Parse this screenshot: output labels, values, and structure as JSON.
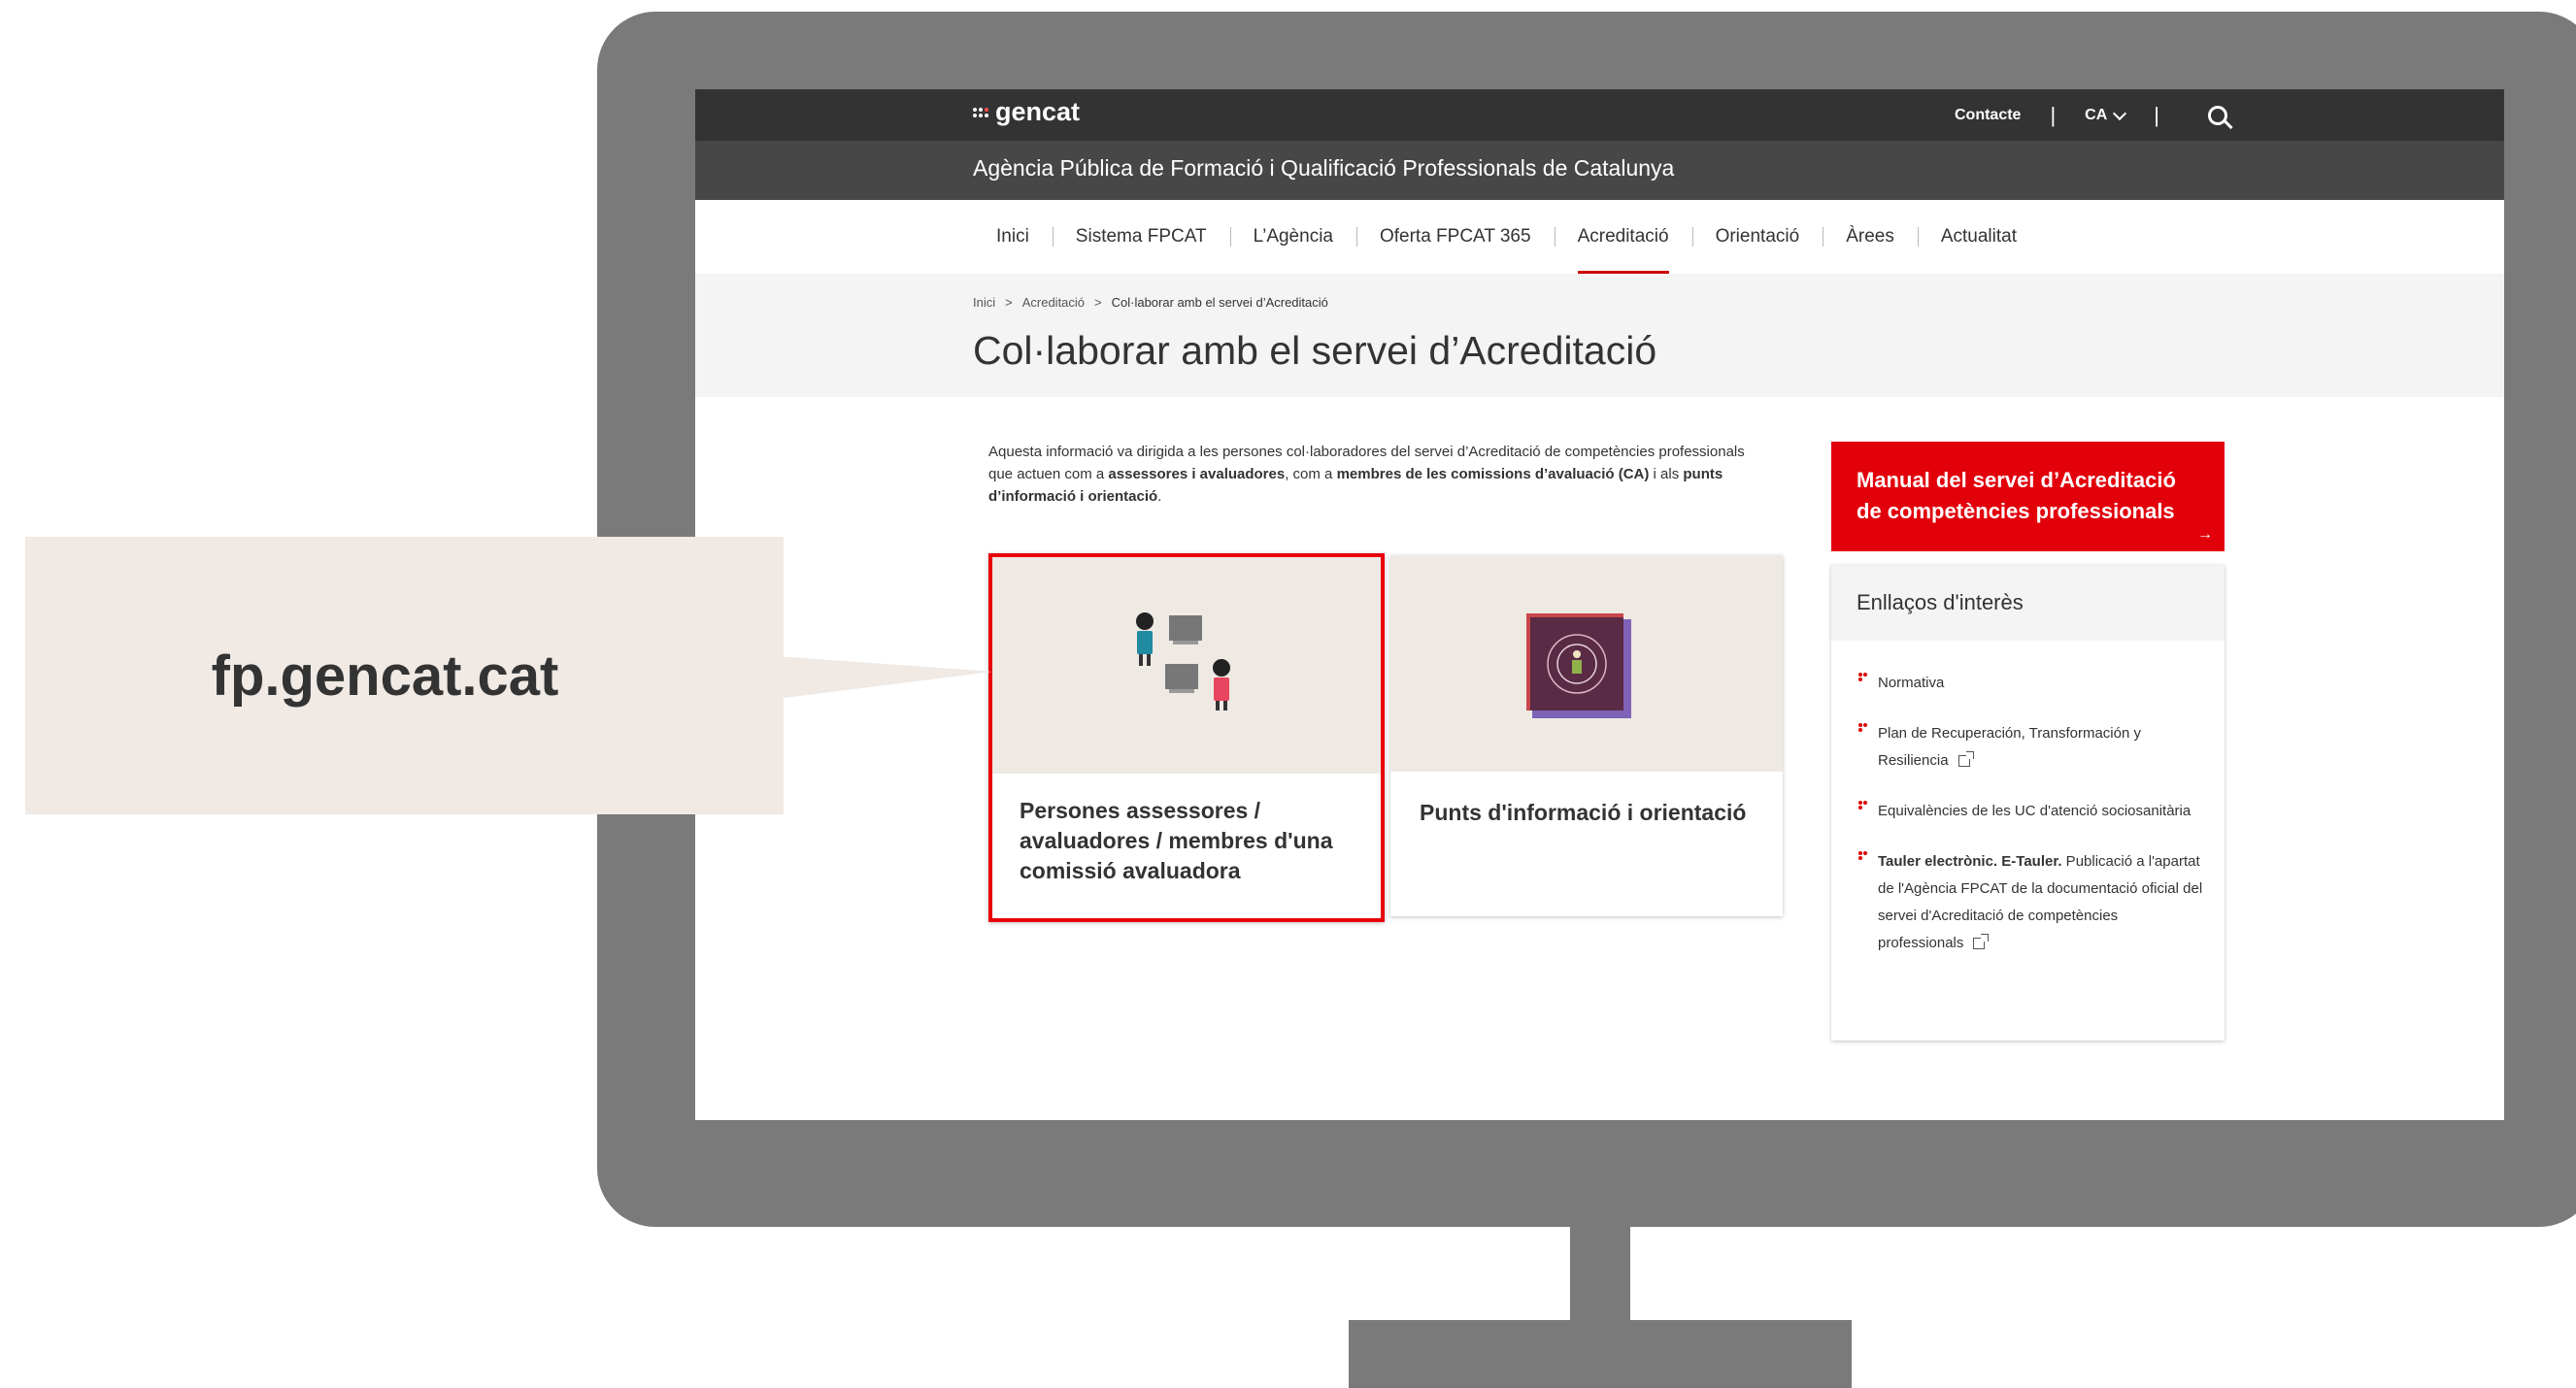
{
  "callout": {
    "text": "fp.gencat.cat"
  },
  "header": {
    "logo": "gencat",
    "contact": "Contacte",
    "language": "CA",
    "separator": "|",
    "agency": "Agència Pública de Formació i Qualificació Professionals de Catalunya"
  },
  "nav": {
    "items": [
      {
        "label": "Inici"
      },
      {
        "label": "Sistema FPCAT"
      },
      {
        "label": "L’Agència"
      },
      {
        "label": "Oferta FPCAT 365"
      },
      {
        "label": "Acreditació"
      },
      {
        "label": "Orientació"
      },
      {
        "label": "Àrees"
      },
      {
        "label": "Actualitat"
      }
    ],
    "active": "Acreditació"
  },
  "breadcrumb": {
    "home": "Inici",
    "section": "Acreditació",
    "current": "Col·laborar amb el servei d’Acreditació",
    "sep": ">"
  },
  "page": {
    "title": "Col·laborar amb el servei d’Acreditació",
    "intro": {
      "t1": "Aquesta informació va dirigida a les persones col·laboradores del servei d’Acreditació de competències professionals que actuen com a ",
      "b1": "assessores i avaluadores",
      "t2": ", com a ",
      "b2": "membres de les comissions d’avaluació (CA)",
      "t3": " i als ",
      "b3": "punts d’informació i orientació",
      "t4": "."
    }
  },
  "cards": [
    {
      "title": "Persones assessores / avaluadores / membres d'una comissió avaluadora"
    },
    {
      "title": "Punts d'informació i orientació"
    }
  ],
  "sidebar": {
    "manual": "Manual del servei d’Acreditació de competències professionals",
    "links_title": "Enllaços d'interès",
    "links": [
      {
        "label": "Normativa"
      },
      {
        "label": "Plan de Recuperación, Transformación y Resiliencia"
      },
      {
        "label": "Equivalències de les UC d'atenció sociosanitària"
      },
      {
        "label_bold": "Tauler electrònic. E-Tauler.",
        "label": " Publicació a l'apartat de l'Agència FPCAT de la documentació oficial del servei d'Acreditació de competències professionals"
      }
    ]
  },
  "colors": {
    "accent": "#e2000b",
    "topbar": "#333333",
    "agency_bar": "#474747",
    "monitor": "#7a7a7a",
    "callout": "#f0e9e4"
  }
}
